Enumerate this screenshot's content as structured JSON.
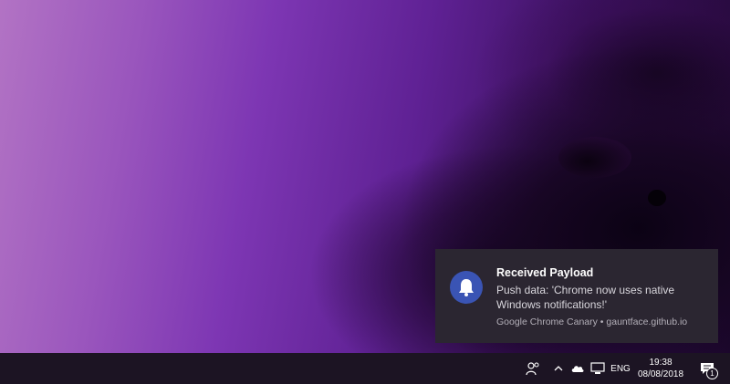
{
  "notification": {
    "icon": "bell-icon",
    "title": "Received Payload",
    "body": "Push data: 'Chrome now uses native Windows notifications!'",
    "source": "Google Chrome Canary • gauntface.github.io",
    "accent_color": "#3a54b4"
  },
  "taskbar": {
    "icons": [
      "people-icon",
      "chevron-up-icon",
      "onedrive-cloud-icon",
      "network-icon"
    ],
    "language": "ENG",
    "time": "19:38",
    "date": "08/08/2018",
    "action_center_count": "1"
  },
  "colors": {
    "toast_bg": "#2b2631",
    "taskbar_bg": "#1c1423"
  }
}
